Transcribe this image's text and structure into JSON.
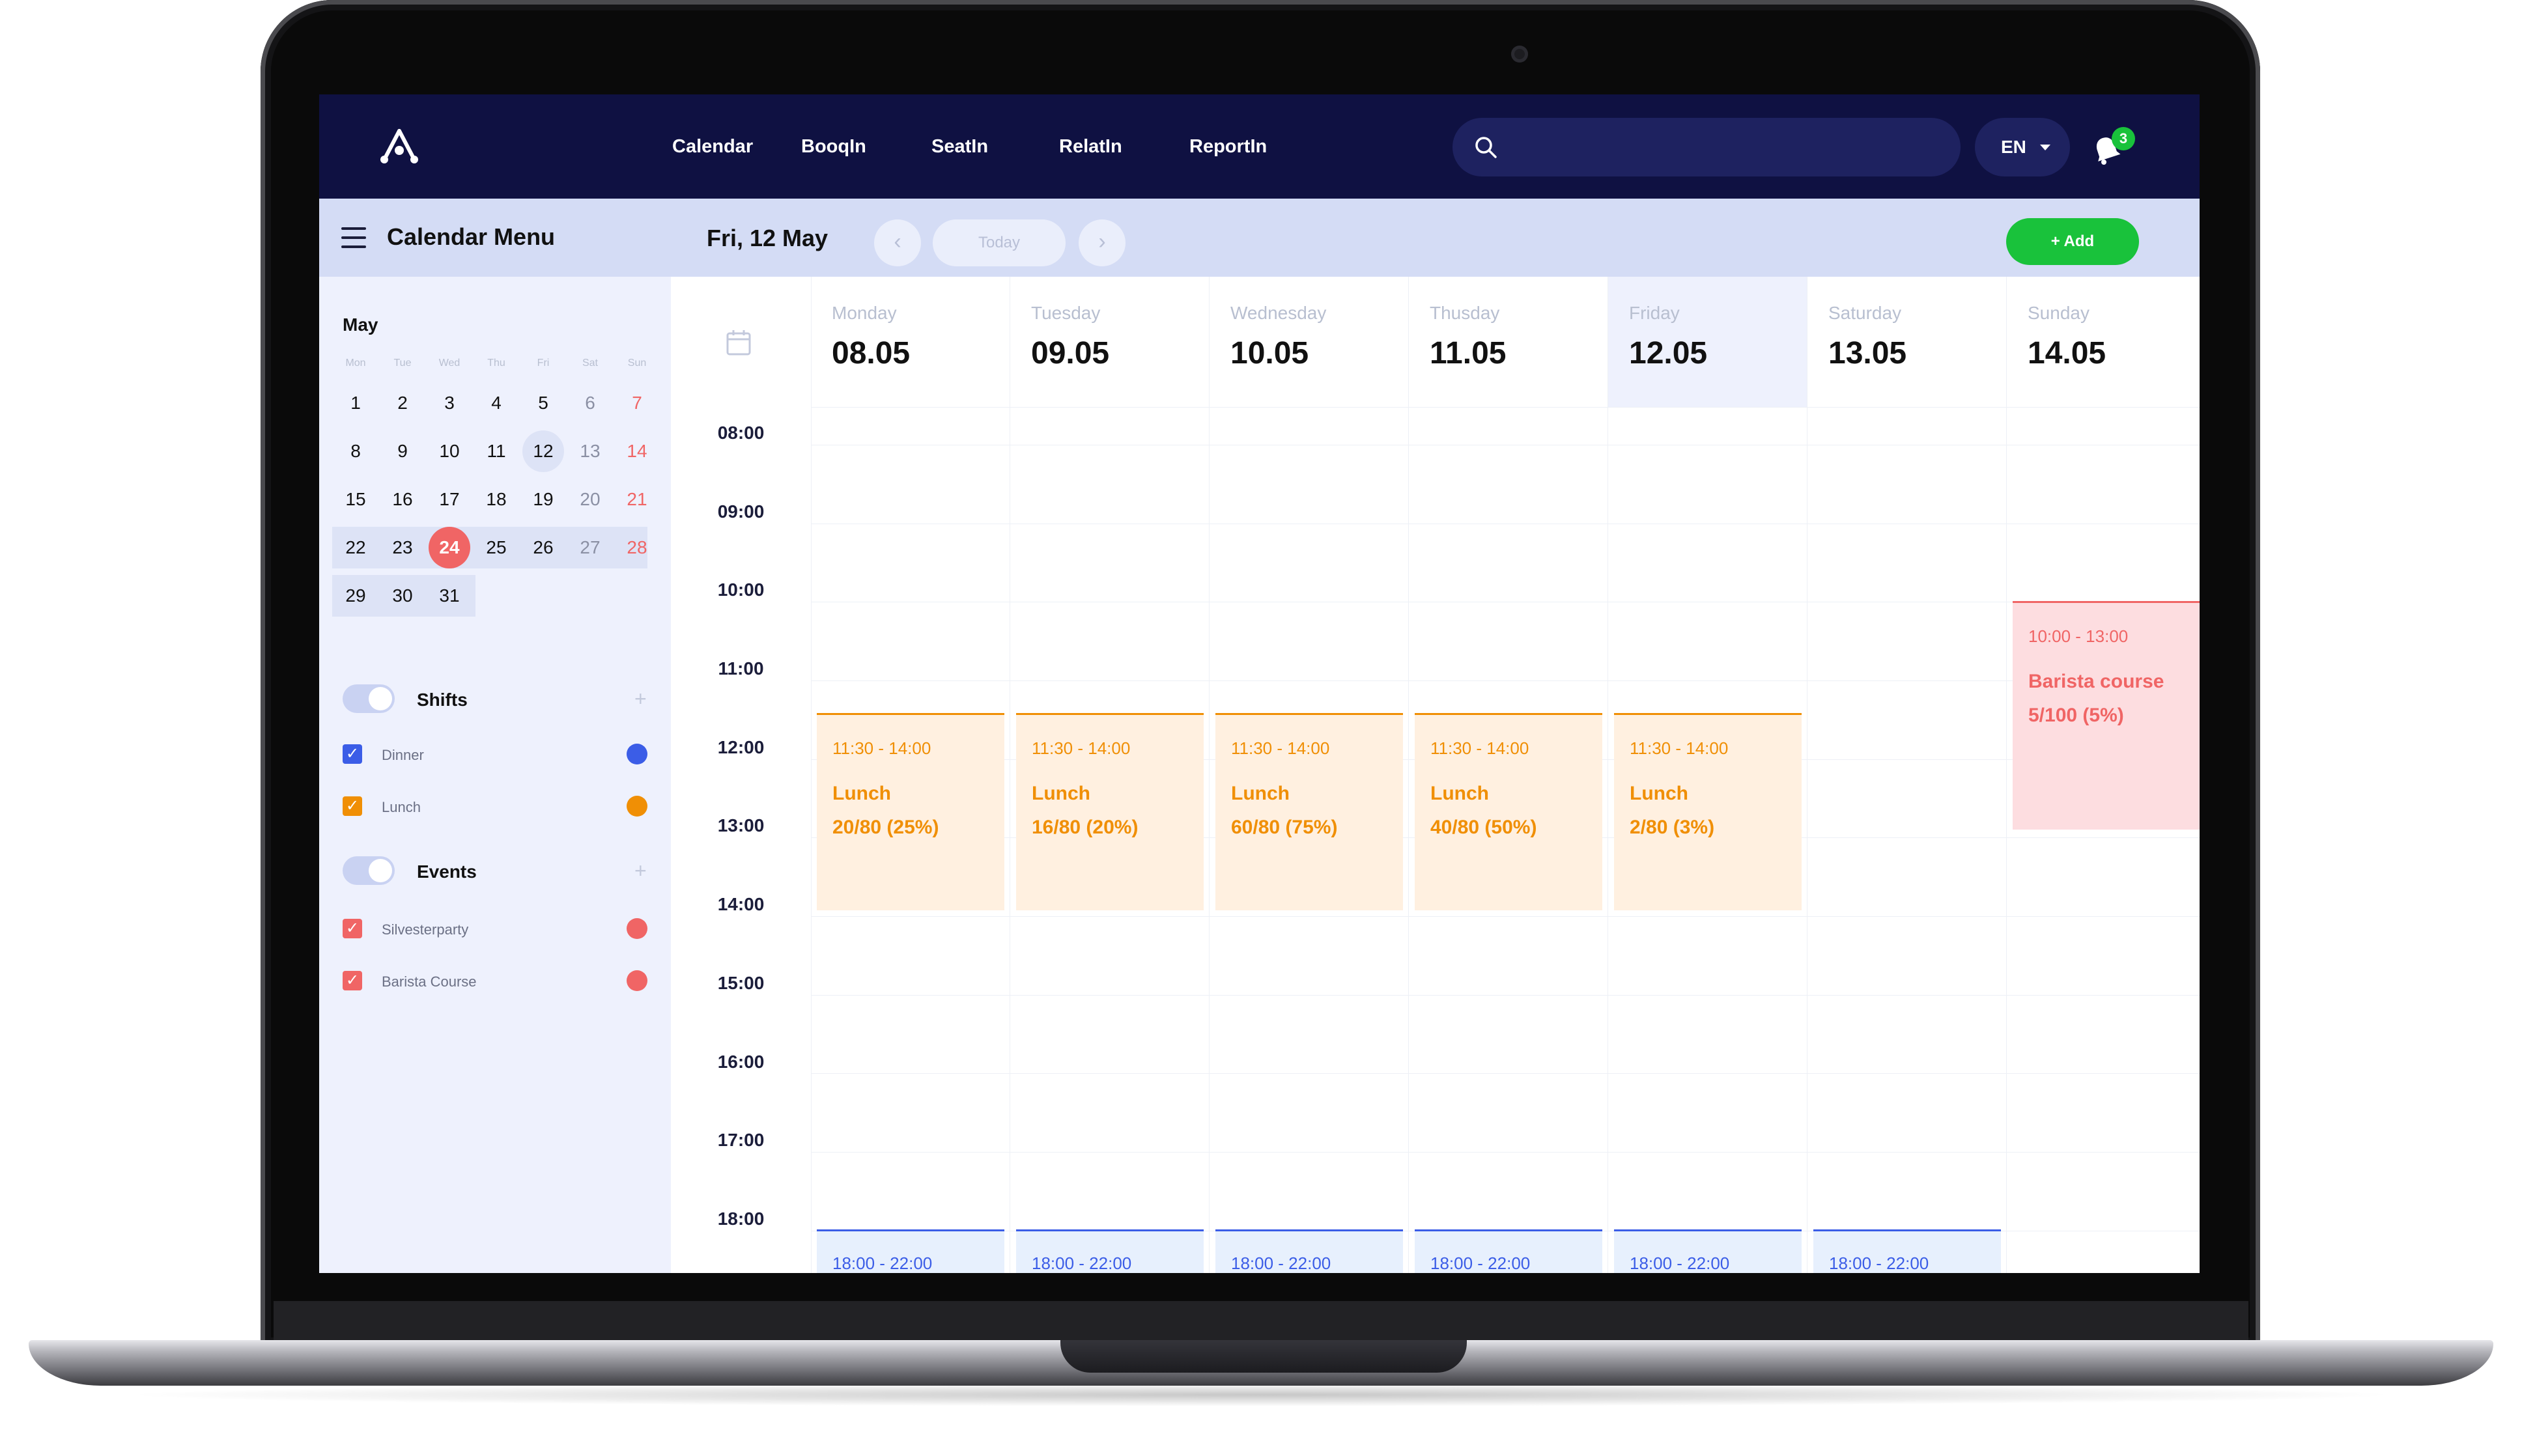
{
  "nav": {
    "logo": "app-logo",
    "items": [
      "Calendar",
      "BooqIn",
      "SeatIn",
      "RelatIn",
      "ReportIn"
    ],
    "search_placeholder": "",
    "language": "EN",
    "notifications_count": "3"
  },
  "toolbar": {
    "menu_title": "Calendar Menu",
    "current_date": "Fri, 12 May",
    "prev_label": "‹",
    "today_label": "Today",
    "next_label": "›",
    "add_label": "+ Add"
  },
  "mini_calendar": {
    "month": "May",
    "weekdays": [
      "Mon",
      "Tue",
      "Wed",
      "Thu",
      "Fri",
      "Sat",
      "Sun"
    ],
    "weeks": [
      [
        "1",
        "2",
        "3",
        "4",
        "5",
        "6",
        "7"
      ],
      [
        "8",
        "9",
        "10",
        "11",
        "12",
        "13",
        "14"
      ],
      [
        "15",
        "16",
        "17",
        "18",
        "19",
        "20",
        "21"
      ],
      [
        "22",
        "23",
        "24",
        "25",
        "26",
        "27",
        "28"
      ],
      [
        "29",
        "30",
        "31"
      ]
    ],
    "selected_day": "24",
    "highlighted_day": "12"
  },
  "filters": {
    "shifts": {
      "title": "Shifts",
      "add": "+",
      "items": [
        {
          "label": "Dinner",
          "color": "#3b5de7"
        },
        {
          "label": "Lunch",
          "color": "#f08f05"
        }
      ]
    },
    "events": {
      "title": "Events",
      "add": "+",
      "items": [
        {
          "label": "Silvesterparty",
          "color": "#f06565"
        },
        {
          "label": "Barista Course",
          "color": "#f06565"
        }
      ]
    }
  },
  "week": {
    "days": [
      {
        "name": "Monday",
        "date": "08.05"
      },
      {
        "name": "Tuesday",
        "date": "09.05"
      },
      {
        "name": "Wednesday",
        "date": "10.05"
      },
      {
        "name": "Thusday",
        "date": "11.05"
      },
      {
        "name": "Friday",
        "date": "12.05",
        "today": true
      },
      {
        "name": "Saturday",
        "date": "13.05"
      },
      {
        "name": "Sunday",
        "date": "14.05"
      }
    ],
    "times": [
      "08:00",
      "09:00",
      "10:00",
      "11:00",
      "12:00",
      "13:00",
      "14:00",
      "15:00",
      "16:00",
      "17:00",
      "18:00"
    ]
  },
  "events": [
    {
      "day": 0,
      "time": "11:30 - 14:00",
      "name": "Lunch",
      "count": "20/80 (25%)",
      "kind": "lunch"
    },
    {
      "day": 1,
      "time": "11:30 - 14:00",
      "name": "Lunch",
      "count": "16/80 (20%)",
      "kind": "lunch"
    },
    {
      "day": 2,
      "time": "11:30 - 14:00",
      "name": "Lunch",
      "count": "60/80 (75%)",
      "kind": "lunch"
    },
    {
      "day": 3,
      "time": "11:30 - 14:00",
      "name": "Lunch",
      "count": "40/80 (50%)",
      "kind": "lunch"
    },
    {
      "day": 4,
      "time": "11:30 - 14:00",
      "name": "Lunch",
      "count": "2/80 (3%)",
      "kind": "lunch"
    },
    {
      "day": 6,
      "time": "10:00 - 13:00",
      "name": "Barista course",
      "count": "5/100 (5%)",
      "kind": "event"
    },
    {
      "day": 0,
      "time": "18:00 - 22:00",
      "kind": "dinner"
    },
    {
      "day": 1,
      "time": "18:00 - 22:00",
      "kind": "dinner"
    },
    {
      "day": 2,
      "time": "18:00 - 22:00",
      "kind": "dinner"
    },
    {
      "day": 3,
      "time": "18:00 - 22:00",
      "kind": "dinner"
    },
    {
      "day": 4,
      "time": "18:00 - 22:00",
      "kind": "dinner"
    },
    {
      "day": 5,
      "time": "18:00 - 22:00",
      "kind": "dinner"
    }
  ],
  "colors": {
    "nav_bg": "#0f1142",
    "toolbar_bg": "#d4dcf5",
    "sidebar_bg": "#eef1fd",
    "lunch": "#f08f05",
    "dinner": "#3b5de7",
    "event": "#f06565",
    "add": "#19c23b"
  }
}
